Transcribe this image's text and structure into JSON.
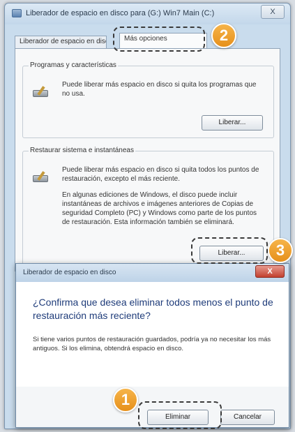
{
  "window": {
    "title": "Liberador de espacio en disco para (G:) Win7 Main (C:)",
    "close_label": "X"
  },
  "tabs": [
    {
      "label": "Liberador de espacio en disco"
    },
    {
      "label": "Más opciones"
    }
  ],
  "programs_group": {
    "title": "Programas y características",
    "description": "Puede liberar más espacio en disco si quita los programas que no usa.",
    "button_label": "Liberar..."
  },
  "restore_group": {
    "title": "Restaurar sistema e instantáneas",
    "description": "Puede liberar más espacio en disco si quita todos los puntos de restauración, excepto el más reciente.",
    "extra": "En algunas ediciones de Windows, el disco puede incluir instantáneas de archivos e imágenes anteriores de Copias de seguridad Completo (PC) y Windows como parte de los puntos de restauración. Esta información también se eliminará.",
    "button_label": "Liberar..."
  },
  "dialog": {
    "title": "Liberador de espacio en disco",
    "close_label": "X",
    "question": "¿Confirma que desea eliminar todos menos el punto de restauración más reciente?",
    "info": "Si tiene varios puntos de restauración guardados, podría ya no necesitar los más antiguos. Si los elimina, obtendrá espacio en disco.",
    "delete_label": "Eliminar",
    "cancel_label": "Cancelar"
  },
  "callouts": [
    {
      "number": "1"
    },
    {
      "number": "2"
    },
    {
      "number": "3"
    }
  ],
  "colors": {
    "badge": "#f0a830",
    "dialog_close": "#c2402f",
    "question_text": "#1f3c7a"
  }
}
